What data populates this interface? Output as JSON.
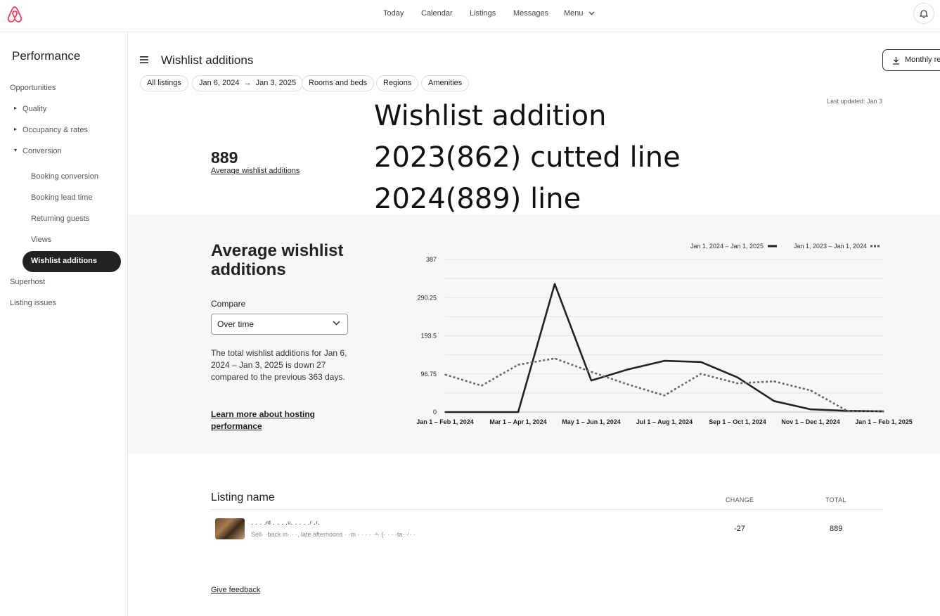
{
  "topnav": {
    "items": [
      "Today",
      "Calendar",
      "Listings",
      "Messages",
      "Menu"
    ]
  },
  "sidebar": {
    "title": "Performance",
    "items": [
      {
        "label": "Opportunities"
      },
      {
        "label": "Quality"
      },
      {
        "label": "Occupancy & rates"
      },
      {
        "label": "Conversion"
      },
      {
        "label": "Booking conversion"
      },
      {
        "label": "Booking lead time"
      },
      {
        "label": "Returning guests"
      },
      {
        "label": "Views"
      },
      {
        "label": "Wishlist additions"
      },
      {
        "label": "Superhost"
      },
      {
        "label": "Listing issues"
      }
    ]
  },
  "header": {
    "title": "Wishlist additions",
    "monthly_button": "Monthly re",
    "last_updated": "Last updated: Jan 3"
  },
  "filters": {
    "all_listings": "All listings",
    "date_start": "Jan 6, 2024",
    "date_end": "Jan 3, 2025",
    "rooms": "Rooms and beds",
    "regions": "Regions",
    "amenities": "Amenities"
  },
  "annotation": {
    "line1": "Wishlist addition",
    "line2": "2023(862) cutted line",
    "line3": "2024(889) line"
  },
  "summary": {
    "value": "889",
    "label": "Average wishlist additions"
  },
  "detail": {
    "title": "Average wishlist additions",
    "compare_label": "Compare",
    "compare_value": "Over time",
    "description": "The total wishlist additions for Jan 6, 2024 – Jan 3, 2025 is down 27 compared to the previous 363 days.",
    "learn_more": "Learn more about hosting performance"
  },
  "chart_data": {
    "type": "line",
    "x_tick_labels": [
      "Jan 1 – Feb 1, 2024",
      "Mar 1 – Apr 1, 2024",
      "May 1 – Jun 1, 2024",
      "Jul 1 – Aug 1, 2024",
      "Sep 1 – Oct 1, 2024",
      "Nov 1 – Dec 1, 2024",
      "Jan 1 – Feb 1, 2025"
    ],
    "x": [
      "Jan 2024",
      "Feb 2024",
      "Mar 2024",
      "Apr 2024",
      "May 2024",
      "Jun 2024",
      "Jul 2024",
      "Aug 2024",
      "Sep 2024",
      "Oct 2024",
      "Nov 2024",
      "Dec 2024",
      "Jan 2025"
    ],
    "y_ticks": [
      "0",
      "96.75",
      "193.5",
      "290.25",
      "387"
    ],
    "ylim": [
      0,
      387
    ],
    "grid": true,
    "legend_position": "top-right",
    "series": [
      {
        "name": "Jan 1, 2024 – Jan 1, 2025",
        "style": "solid",
        "color": "#222222",
        "values": [
          0,
          0,
          0,
          325,
          80,
          108,
          130,
          127,
          88,
          28,
          7,
          3,
          2
        ]
      },
      {
        "name": "Jan 1, 2023 – Jan 1, 2024",
        "style": "dotted",
        "color": "#666666",
        "values": [
          95,
          67,
          120,
          136,
          102,
          70,
          42,
          97,
          73,
          78,
          55,
          3,
          2
        ]
      }
    ]
  },
  "table": {
    "title": "Listing name",
    "col_change": "CHANGE",
    "col_total": "TOTAL",
    "rows": [
      {
        "name": "· · · ·ʳᵈ · · · ·ᵘ· · · · ·ʳ ·ʳ·",
        "sub": "Sell· ·back in· · ·, late afternoons · ·m · · · · ·ᵃ· (· · · ·ta· ·ⁱ· ·",
        "change": "-27",
        "total": "889"
      }
    ]
  },
  "footer": {
    "feedback": "Give feedback"
  }
}
